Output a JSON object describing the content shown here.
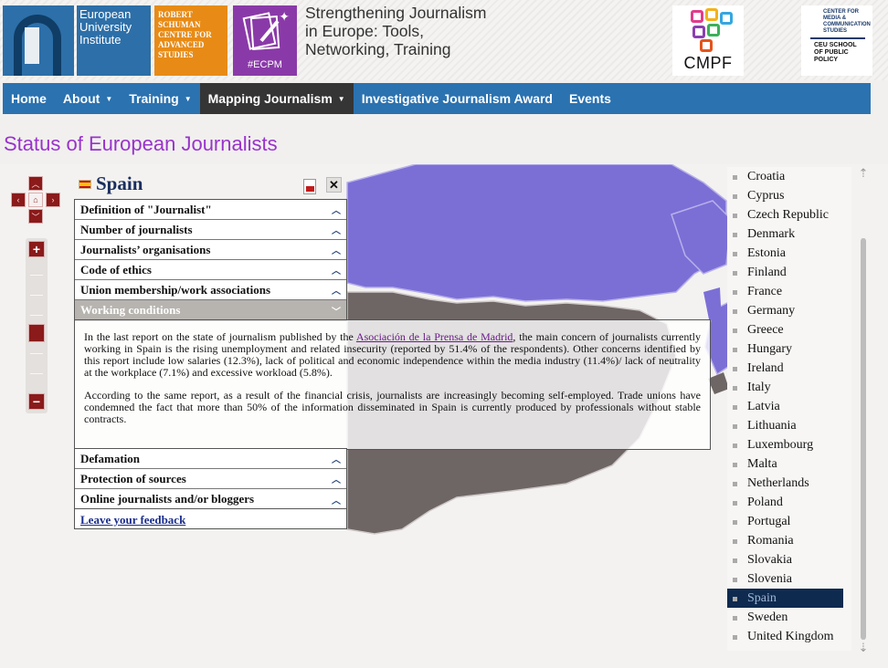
{
  "header": {
    "eui_logo": {
      "line1": "European",
      "line2": "University",
      "line3": "Institute"
    },
    "rsc_logo": {
      "line1": "ROBERT",
      "line2": "SCHUMAN",
      "line3": "CENTRE FOR",
      "line4": "ADVANCED",
      "line5": "STUDIES"
    },
    "ecpm_logo": {
      "tag": "#ECPM"
    },
    "site_title": {
      "line1": "Strengthening Journalism",
      "line2": "in Europe: Tools,",
      "line3": "Networking, Training"
    },
    "cmpf_logo": {
      "text": "CMPF"
    },
    "ceu_logo": {
      "line1": "CENTER FOR",
      "line2": "MEDIA &",
      "line3": "COMMUNICATION",
      "line4": "STUDIES",
      "line5": "CEU SCHOOL",
      "line6": "OF PUBLIC",
      "line7": "POLICY"
    }
  },
  "nav": {
    "home": "Home",
    "about": "About",
    "training": "Training",
    "mapping": "Mapping Journalism",
    "award": "Investigative Journalism Award",
    "events": "Events"
  },
  "page": {
    "title": "Status of European Journalists"
  },
  "map_controls": {
    "home_label": "⌂",
    "zoom_in": "+",
    "zoom_out": "−",
    "zoom_level": 0.5
  },
  "colors": {
    "map_highlight": "#7b6fd6",
    "map_selected": "#6e6565",
    "map_background": "#f3f2f0",
    "nav_bar": "#2b72b0",
    "title_purple": "#9933cc",
    "list_selected": "#0e2a4f"
  },
  "country_panel": {
    "country": "Spain",
    "sections": [
      "Definition of \"Journalist\"",
      "Number of journalists",
      "Journalists’ organisations",
      "Code of ethics",
      "Union membership/work associations",
      "Working conditions"
    ],
    "sections_after": [
      "Defamation",
      "Protection of sources",
      "Online journalists and/or bloggers"
    ],
    "content": {
      "p1_before": "In the last report on the state of journalism published by the ",
      "p1_link": "Asociación de la Prensa de Madrid",
      "p1_after": ", the main concern of journalists currently working in Spain is the rising unemployment and related insecurity (reported by 51.4% of the respondents). Other concerns identified by this report include low salaries (12.3%), lack of political and economic independence within the media industry (11.4%)/ lack of neutrality at the workplace (7.1%) and excessive workload (5.8%).",
      "p2": "According to the same report, as a result of the financial crisis, journalists are increasingly becoming self-employed. Trade unions have condemned the fact that more than 50% of the information disseminated in Spain is currently produced by professionals without stable contracts."
    },
    "feedback": "Leave your feedback"
  },
  "country_list": {
    "selected": "Spain",
    "items": [
      "Croatia",
      "Cyprus",
      "Czech Republic",
      "Denmark",
      "Estonia",
      "Finland",
      "France",
      "Germany",
      "Greece",
      "Hungary",
      "Ireland",
      "Italy",
      "Latvia",
      "Lithuania",
      "Luxembourg",
      "Malta",
      "Netherlands",
      "Poland",
      "Portugal",
      "Romania",
      "Slovakia",
      "Slovenia",
      "Spain",
      "Sweden",
      "United Kingdom"
    ]
  }
}
